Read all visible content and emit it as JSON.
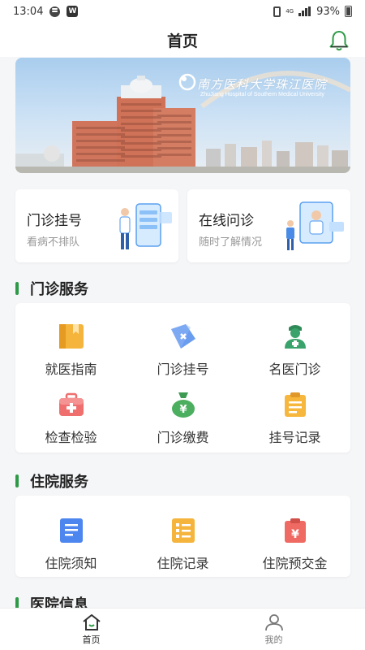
{
  "status_bar": {
    "time": "13:04",
    "network_label": "4G",
    "battery": "93%"
  },
  "header": {
    "title": "首页"
  },
  "banner": {
    "logo_text": "南方医科大学珠江医院",
    "logo_subtitle": "ZhuJiang Hospital of Southern Medical University"
  },
  "quick_entries": [
    {
      "title": "门诊挂号",
      "subtitle": "看病不排队",
      "icon": "phone-registration-illustration"
    },
    {
      "title": "在线问诊",
      "subtitle": "随时了解情况",
      "icon": "online-consult-illustration"
    }
  ],
  "outpatient": {
    "title": "门诊服务",
    "items": [
      {
        "label": "就医指南",
        "icon": "guide-book-icon",
        "color": "#f5b53d"
      },
      {
        "label": "门诊挂号",
        "icon": "ticket-tag-icon",
        "color": "#6a9cf0"
      },
      {
        "label": "名医门诊",
        "icon": "doctor-icon",
        "color": "#3aa36b"
      },
      {
        "label": "检查检验",
        "icon": "medical-kit-icon",
        "color": "#ef6f6f"
      },
      {
        "label": "门诊缴费",
        "icon": "money-bag-icon",
        "color": "#4caf60"
      },
      {
        "label": "挂号记录",
        "icon": "clipboard-icon",
        "color": "#f6b73c"
      }
    ]
  },
  "inpatient": {
    "title": "住院服务",
    "items": [
      {
        "label": "住院须知",
        "icon": "notice-doc-icon",
        "color": "#4d86ee"
      },
      {
        "label": "住院记录",
        "icon": "record-list-icon",
        "color": "#f5b53d"
      },
      {
        "label": "住院预交金",
        "icon": "deposit-clipboard-icon",
        "color": "#ee6a63"
      }
    ]
  },
  "hospital_info": {
    "title": "医院信息"
  },
  "tabbar": {
    "items": [
      {
        "label": "首页",
        "icon": "home-icon",
        "active": true
      },
      {
        "label": "我的",
        "icon": "profile-icon",
        "active": false
      }
    ]
  },
  "colors": {
    "accent_green": "#2e9a47"
  }
}
